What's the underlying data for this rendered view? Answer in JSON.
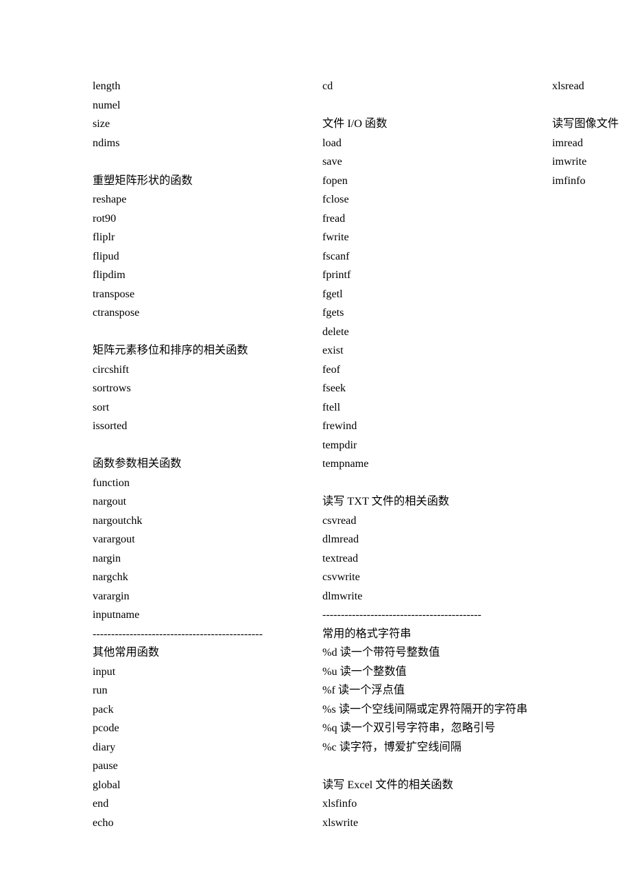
{
  "left_column": [
    "length",
    "numel",
    "size",
    "ndims",
    "",
    "重塑矩阵形状的函数",
    "reshape",
    "rot90",
    "fliplr",
    "flipud",
    "flipdim",
    "transpose",
    "ctranspose",
    "",
    "矩阵元素移位和排序的相关函数",
    "circshift",
    "sortrows",
    "sort",
    "issorted",
    "",
    "函数参数相关函数",
    "function",
    "nargout",
    "nargoutchk",
    "varargout",
    "nargin",
    "nargchk",
    "varargin",
    "inputname",
    "----------------------------------------------",
    "其他常用函数",
    "input",
    "run",
    "pack",
    "pcode",
    "diary",
    "pause",
    "global",
    "end",
    "echo",
    "cd",
    "",
    "文件 I/O 函数",
    "load"
  ],
  "right_column": [
    "save",
    "fopen",
    "fclose",
    "fread",
    "fwrite",
    "fscanf",
    "fprintf",
    "fgetl",
    "fgets",
    "delete",
    "exist",
    "feof",
    "fseek",
    "ftell",
    "frewind",
    "tempdir",
    "tempname",
    "",
    "读写 TXT 文件的相关函数",
    "csvread",
    "dlmread",
    "textread",
    "csvwrite",
    "dlmwrite",
    "-------------------------------------------",
    "常用的格式字符串",
    "%d 读一个带符号整数值",
    "%u 读一个整数值",
    "%f 读一个浮点值",
    "%s 读一个空线间隔或定界符隔开的字符串",
    "%q 读一个双引号字符串，忽略引号",
    "%c 读字符，博爱扩空线间隔",
    "",
    "读写 Excel 文件的相关函数",
    "xlsfinfo",
    "xlswrite",
    "xlsread",
    "",
    "读写图像文件",
    "imread",
    "imwrite",
    "imfinfo"
  ]
}
